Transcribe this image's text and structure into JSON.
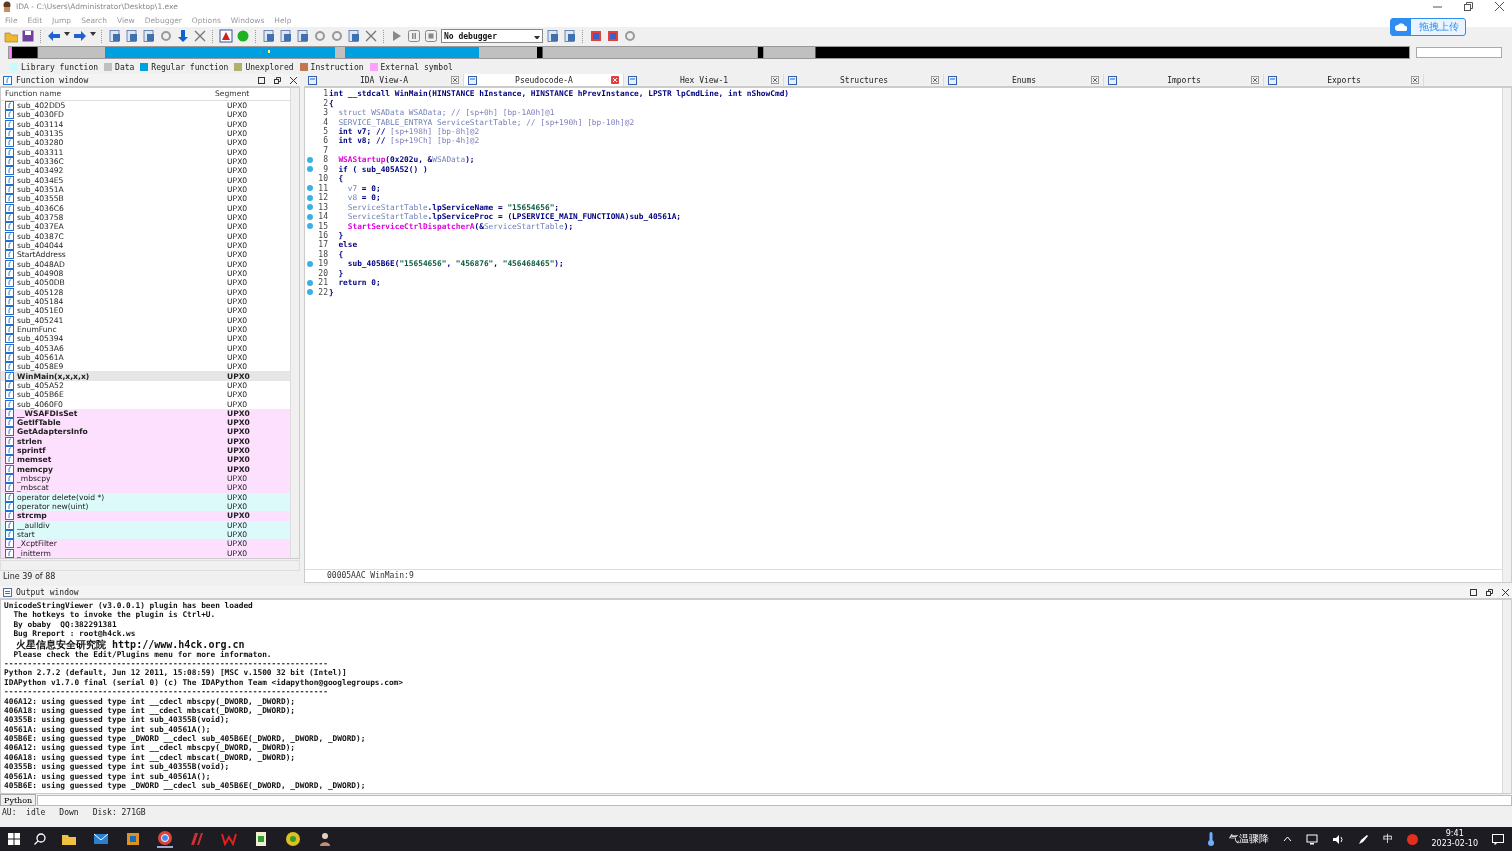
{
  "window": {
    "title": "IDA - C:\\Users\\Administrator\\Desktop\\1.exe"
  },
  "menu": [
    "File",
    "Edit",
    "Jump",
    "Search",
    "View",
    "Debugger",
    "Options",
    "Windows",
    "Help"
  ],
  "upload_button": "拖拽上传",
  "toolbar": {
    "debugger_select": "No debugger"
  },
  "legend": [
    {
      "label": "Library function",
      "color": "#c8fcfc"
    },
    {
      "label": "Data",
      "color": "#c0c0c0"
    },
    {
      "label": "Regular function",
      "color": "#00a0e0"
    },
    {
      "label": "Unexplored",
      "color": "#b0b070"
    },
    {
      "label": "Instruction",
      "color": "#c07850"
    },
    {
      "label": "External symbol",
      "color": "#ffa0ff"
    }
  ],
  "function_window": {
    "title": "Function window",
    "columns": [
      "Function name",
      "Segment"
    ],
    "status": "Line 39 of 88",
    "rows": [
      {
        "name": "sub_402DD5",
        "segment": "UPX0",
        "kind": "regular",
        "bold": false,
        "selected": false
      },
      {
        "name": "sub_4030FD",
        "segment": "UPX0",
        "kind": "regular",
        "bold": false,
        "selected": false
      },
      {
        "name": "sub_403114",
        "segment": "UPX0",
        "kind": "regular",
        "bold": false,
        "selected": false
      },
      {
        "name": "sub_403135",
        "segment": "UPX0",
        "kind": "regular",
        "bold": false,
        "selected": false
      },
      {
        "name": "sub_403280",
        "segment": "UPX0",
        "kind": "regular",
        "bold": false,
        "selected": false
      },
      {
        "name": "sub_403311",
        "segment": "UPX0",
        "kind": "regular",
        "bold": false,
        "selected": false
      },
      {
        "name": "sub_40336C",
        "segment": "UPX0",
        "kind": "regular",
        "bold": false,
        "selected": false
      },
      {
        "name": "sub_403492",
        "segment": "UPX0",
        "kind": "regular",
        "bold": false,
        "selected": false
      },
      {
        "name": "sub_4034E5",
        "segment": "UPX0",
        "kind": "regular",
        "bold": false,
        "selected": false
      },
      {
        "name": "sub_40351A",
        "segment": "UPX0",
        "kind": "regular",
        "bold": false,
        "selected": false
      },
      {
        "name": "sub_40355B",
        "segment": "UPX0",
        "kind": "regular",
        "bold": false,
        "selected": false
      },
      {
        "name": "sub_4036C6",
        "segment": "UPX0",
        "kind": "regular",
        "bold": false,
        "selected": false
      },
      {
        "name": "sub_403758",
        "segment": "UPX0",
        "kind": "regular",
        "bold": false,
        "selected": false
      },
      {
        "name": "sub_4037EA",
        "segment": "UPX0",
        "kind": "regular",
        "bold": false,
        "selected": false
      },
      {
        "name": "sub_40387C",
        "segment": "UPX0",
        "kind": "regular",
        "bold": false,
        "selected": false
      },
      {
        "name": "sub_404044",
        "segment": "UPX0",
        "kind": "regular",
        "bold": false,
        "selected": false
      },
      {
        "name": "StartAddress",
        "segment": "UPX0",
        "kind": "regular",
        "bold": false,
        "selected": false
      },
      {
        "name": "sub_4048AD",
        "segment": "UPX0",
        "kind": "regular",
        "bold": false,
        "selected": false
      },
      {
        "name": "sub_404908",
        "segment": "UPX0",
        "kind": "regular",
        "bold": false,
        "selected": false
      },
      {
        "name": "sub_4050DB",
        "segment": "UPX0",
        "kind": "regular",
        "bold": false,
        "selected": false
      },
      {
        "name": "sub_405128",
        "segment": "UPX0",
        "kind": "regular",
        "bold": false,
        "selected": false
      },
      {
        "name": "sub_405184",
        "segment": "UPX0",
        "kind": "regular",
        "bold": false,
        "selected": false
      },
      {
        "name": "sub_4051E0",
        "segment": "UPX0",
        "kind": "regular",
        "bold": false,
        "selected": false
      },
      {
        "name": "sub_405241",
        "segment": "UPX0",
        "kind": "regular",
        "bold": false,
        "selected": false
      },
      {
        "name": "EnumFunc",
        "segment": "UPX0",
        "kind": "regular",
        "bold": false,
        "selected": false
      },
      {
        "name": "sub_405394",
        "segment": "UPX0",
        "kind": "regular",
        "bold": false,
        "selected": false
      },
      {
        "name": "sub_4053A6",
        "segment": "UPX0",
        "kind": "regular",
        "bold": false,
        "selected": false
      },
      {
        "name": "sub_40561A",
        "segment": "UPX0",
        "kind": "regular",
        "bold": false,
        "selected": false
      },
      {
        "name": "sub_4058E9",
        "segment": "UPX0",
        "kind": "regular",
        "bold": false,
        "selected": false
      },
      {
        "name": "WinMain(x,x,x,x)",
        "segment": "UPX0",
        "kind": "regular",
        "bold": true,
        "selected": true
      },
      {
        "name": "sub_405A52",
        "segment": "UPX0",
        "kind": "regular",
        "bold": false,
        "selected": false
      },
      {
        "name": "sub_405B6E",
        "segment": "UPX0",
        "kind": "regular",
        "bold": false,
        "selected": false
      },
      {
        "name": "sub_4060F0",
        "segment": "UPX0",
        "kind": "regular",
        "bold": false,
        "selected": false
      },
      {
        "name": "__WSAFDIsSet",
        "segment": "UPX0",
        "kind": "import",
        "bold": true,
        "selected": false
      },
      {
        "name": "GetIfTable",
        "segment": "UPX0",
        "kind": "import",
        "bold": true,
        "selected": false
      },
      {
        "name": "GetAdaptersInfo",
        "segment": "UPX0",
        "kind": "import",
        "bold": true,
        "selected": false
      },
      {
        "name": "strlen",
        "segment": "UPX0",
        "kind": "import",
        "bold": true,
        "selected": false
      },
      {
        "name": "sprintf",
        "segment": "UPX0",
        "kind": "import",
        "bold": true,
        "selected": false
      },
      {
        "name": "memset",
        "segment": "UPX0",
        "kind": "import",
        "bold": true,
        "selected": false
      },
      {
        "name": "memcpy",
        "segment": "UPX0",
        "kind": "import",
        "bold": true,
        "selected": false
      },
      {
        "name": "_mbscpy",
        "segment": "UPX0",
        "kind": "import",
        "bold": false,
        "selected": false
      },
      {
        "name": "_mbscat",
        "segment": "UPX0",
        "kind": "import",
        "bold": false,
        "selected": false
      },
      {
        "name": "operator delete(void *)",
        "segment": "UPX0",
        "kind": "library",
        "bold": false,
        "selected": false
      },
      {
        "name": "operator new(uint)",
        "segment": "UPX0",
        "kind": "library",
        "bold": false,
        "selected": false
      },
      {
        "name": "strcmp",
        "segment": "UPX0",
        "kind": "import",
        "bold": true,
        "selected": false
      },
      {
        "name": "__aulldiv",
        "segment": "UPX0",
        "kind": "library",
        "bold": false,
        "selected": false
      },
      {
        "name": "start",
        "segment": "UPX0",
        "kind": "library",
        "bold": false,
        "selected": false
      },
      {
        "name": "_XcptFilter",
        "segment": "UPX0",
        "kind": "import",
        "bold": false,
        "selected": false
      },
      {
        "name": "_initterm",
        "segment": "UPX0",
        "kind": "import",
        "bold": false,
        "selected": false
      }
    ]
  },
  "tabs": [
    {
      "label": "IDA View-A",
      "selected": false
    },
    {
      "label": "Pseudocode-A",
      "selected": true
    },
    {
      "label": "Hex View-1",
      "selected": false
    },
    {
      "label": "Structures",
      "selected": false
    },
    {
      "label": "Enums",
      "selected": false
    },
    {
      "label": "Imports",
      "selected": false
    },
    {
      "label": "Exports",
      "selected": false
    }
  ],
  "pseudocode": {
    "location": "00005AAC WinMain:9",
    "lines": [
      {
        "num": "1",
        "marked": false,
        "tokens": [
          {
            "kind": "plain",
            "text": "int __stdcall WinMain(HINSTANCE hInstance, HINSTANCE hPrevInstance, LPSTR lpCmdLine, int nShowCmd)"
          }
        ]
      },
      {
        "num": "2",
        "marked": false,
        "tokens": [
          {
            "kind": "plain",
            "text": "{"
          }
        ]
      },
      {
        "num": "3",
        "marked": false,
        "tokens": [
          {
            "kind": "var",
            "text": "  struct WSAData WSAData; "
          },
          {
            "kind": "comment",
            "text": "// [sp+0h] [bp-1A0h]@1"
          }
        ]
      },
      {
        "num": "4",
        "marked": false,
        "tokens": [
          {
            "kind": "var",
            "text": "  SERVICE_TABLE_ENTRYA ServiceStartTable; "
          },
          {
            "kind": "comment",
            "text": "// [sp+190h] [bp-10h]@2"
          }
        ]
      },
      {
        "num": "5",
        "marked": false,
        "tokens": [
          {
            "kind": "plain",
            "text": "  int v7; // "
          },
          {
            "kind": "comment",
            "text": "[sp+198h] [bp-8h]@2"
          }
        ]
      },
      {
        "num": "6",
        "marked": false,
        "tokens": [
          {
            "kind": "plain",
            "text": "  int v8; // "
          },
          {
            "kind": "comment",
            "text": "[sp+19Ch] [bp-4h]@2"
          }
        ]
      },
      {
        "num": "7",
        "marked": false
      },
      {
        "num": "8",
        "marked": true,
        "tokens": [
          {
            "kind": "lib",
            "text": "  WSAStartup"
          },
          {
            "kind": "plain",
            "text": "(0x202u, &"
          },
          {
            "kind": "var",
            "text": "WSAData"
          },
          {
            "kind": "plain",
            "text": ");"
          }
        ]
      },
      {
        "num": "9",
        "marked": true,
        "tokens": [
          {
            "kind": "plain",
            "text": "  if ( sub_405A52() )"
          }
        ]
      },
      {
        "num": "10",
        "marked": false,
        "tokens": [
          {
            "kind": "plain",
            "text": "  {"
          }
        ]
      },
      {
        "num": "11",
        "marked": true,
        "tokens": [
          {
            "kind": "var",
            "text": "    v7"
          },
          {
            "kind": "plain",
            "text": " = 0;"
          }
        ]
      },
      {
        "num": "12",
        "marked": true,
        "tokens": [
          {
            "kind": "var",
            "text": "    v8"
          },
          {
            "kind": "plain",
            "text": " = 0;"
          }
        ]
      },
      {
        "num": "13",
        "marked": true,
        "tokens": [
          {
            "kind": "var",
            "text": "    ServiceStartTable"
          },
          {
            "kind": "plain",
            "text": ".lpServiceName = "
          },
          {
            "kind": "str",
            "text": "\"15654656\""
          },
          {
            "kind": "plain",
            "text": ";"
          }
        ]
      },
      {
        "num": "14",
        "marked": true,
        "tokens": [
          {
            "kind": "var",
            "text": "    ServiceStartTable"
          },
          {
            "kind": "plain",
            "text": ".lpServiceProc = (LPSERVICE_MAIN_FUNCTIONA)sub_40561A;"
          }
        ]
      },
      {
        "num": "15",
        "marked": true,
        "tokens": [
          {
            "kind": "lib",
            "text": "    StartServiceCtrlDispatcherA"
          },
          {
            "kind": "plain",
            "text": "(&"
          },
          {
            "kind": "var",
            "text": "ServiceStartTable"
          },
          {
            "kind": "plain",
            "text": ");"
          }
        ]
      },
      {
        "num": "16",
        "marked": false,
        "tokens": [
          {
            "kind": "plain",
            "text": "  }"
          }
        ]
      },
      {
        "num": "17",
        "marked": false,
        "tokens": [
          {
            "kind": "plain",
            "text": "  else"
          }
        ]
      },
      {
        "num": "18",
        "marked": false,
        "tokens": [
          {
            "kind": "plain",
            "text": "  {"
          }
        ]
      },
      {
        "num": "19",
        "marked": true,
        "tokens": [
          {
            "kind": "plain",
            "text": "    sub_405B6E("
          },
          {
            "kind": "str",
            "text": "\"15654656\""
          },
          {
            "kind": "plain",
            "text": ", "
          },
          {
            "kind": "str",
            "text": "\"456876\""
          },
          {
            "kind": "plain",
            "text": ", "
          },
          {
            "kind": "str",
            "text": "\"456468465\""
          },
          {
            "kind": "plain",
            "text": ");"
          }
        ]
      },
      {
        "num": "20",
        "marked": false,
        "tokens": [
          {
            "kind": "plain",
            "text": "  }"
          }
        ]
      },
      {
        "num": "21",
        "marked": true,
        "tokens": [
          {
            "kind": "plain",
            "text": "  return 0;"
          }
        ]
      },
      {
        "num": "22",
        "marked": true,
        "tokens": [
          {
            "kind": "plain",
            "text": "}"
          }
        ]
      }
    ]
  },
  "output": {
    "title": "Output window",
    "prompt": "Python",
    "lines": [
      "UnicodeStringViewer (v3.0.0.1) plugin has been loaded",
      "  The hotkeys to invoke the plugin is Ctrl+U.",
      "  By obaby  QQ:382291381",
      "  Bug Rreport : root@h4ck.ws",
      "  火星信息安全研究院 http://www.h4ck.org.cn",
      "  Please check the Edit/Plugins menu for more informaton.",
      "---------------------------------------------------------------------",
      "Python 2.7.2 (default, Jun 12 2011, 15:08:59) [MSC v.1500 32 bit (Intel)]",
      "IDAPython v1.7.0 final (serial 0) (c) The IDAPython Team <idapython@googlegroups.com>",
      "---------------------------------------------------------------------",
      "406A12: using guessed type int __cdecl mbscpy(_DWORD, _DWORD);",
      "406A18: using guessed type int __cdecl mbscat(_DWORD, _DWORD);",
      "40355B: using guessed type int sub_40355B(void);",
      "40561A: using guessed type int sub_40561A();",
      "405B6E: using guessed type _DWORD __cdecl sub_405B6E(_DWORD, _DWORD, _DWORD);",
      "406A12: using guessed type int __cdecl mbscpy(_DWORD, _DWORD);",
      "406A18: using guessed type int __cdecl mbscat(_DWORD, _DWORD);",
      "40355B: using guessed type int sub_40355B(void);",
      "40561A: using guessed type int sub_40561A();",
      "405B6E: using guessed type _DWORD __cdecl sub_405B6E(_DWORD, _DWORD, _DWORD);"
    ]
  },
  "status_bar": [
    "AU:  idle",
    "Down",
    "Disk: 271GB"
  ],
  "taskbar": {
    "weather": "气温骤降",
    "ime": "中",
    "time": "9:41",
    "date": "2023-02-10"
  }
}
